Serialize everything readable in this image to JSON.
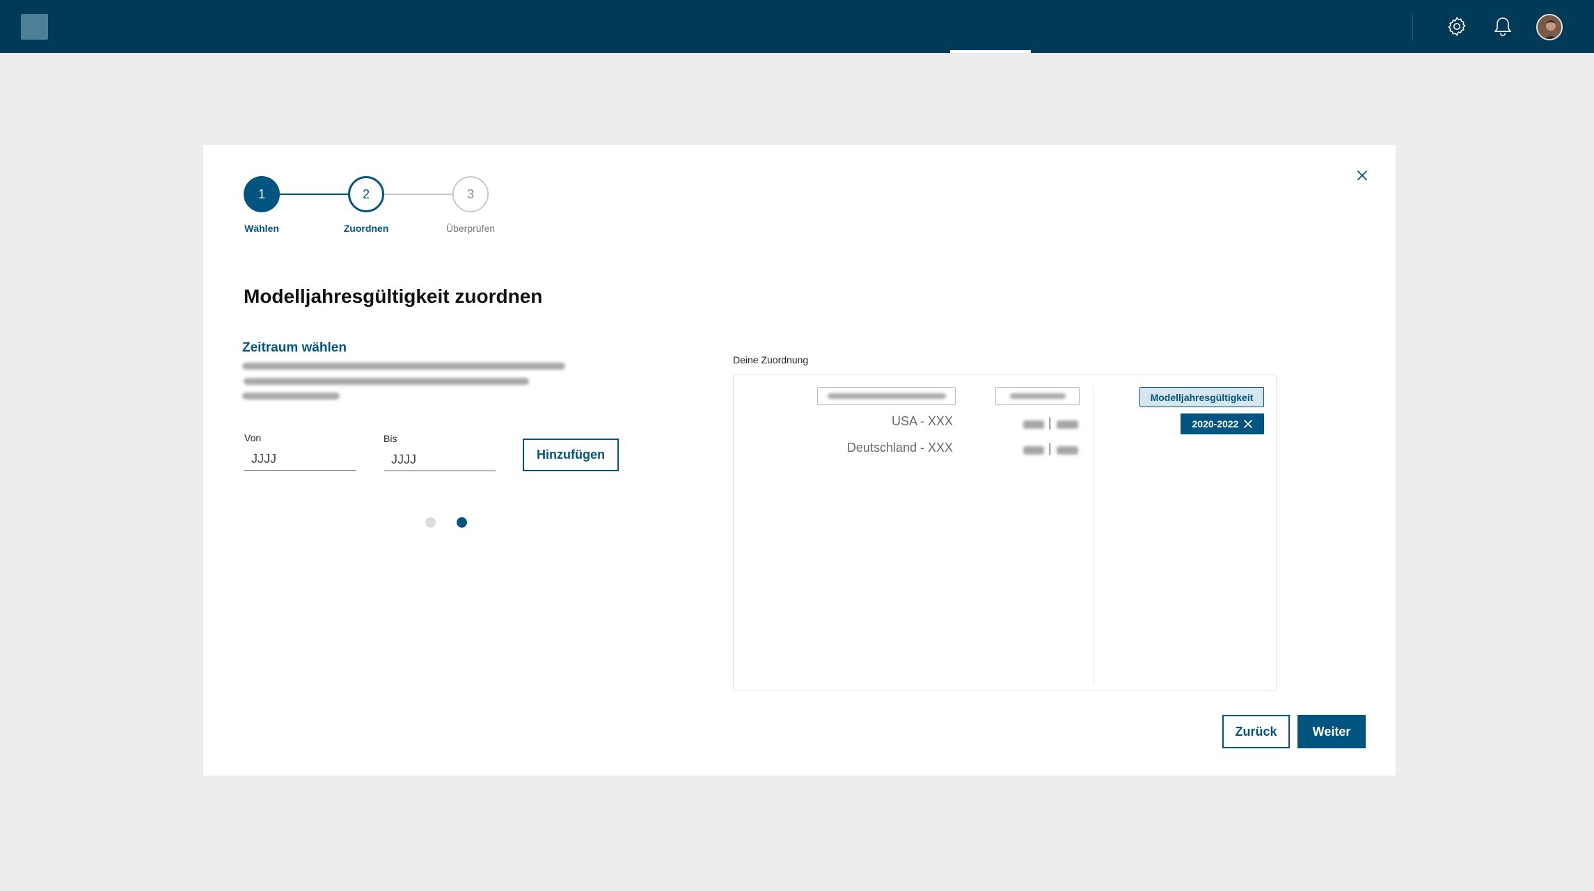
{
  "stepper": {
    "steps": [
      {
        "number": "1",
        "label": "Wählen"
      },
      {
        "number": "2",
        "label": "Zuordnen"
      },
      {
        "number": "3",
        "label": "Überprüfen"
      }
    ]
  },
  "page": {
    "title": "Modelljahresgültigkeit zuordnen"
  },
  "form": {
    "section_title": "Zeitraum wählen",
    "from_label": "Von",
    "from_placeholder": "JJJJ",
    "to_label": "Bis",
    "to_placeholder": "JJJJ",
    "add_button": "Hinzufügen"
  },
  "assignment": {
    "label": "Deine Zuordnung",
    "rows": [
      {
        "name": "USA - XXX"
      },
      {
        "name": "Deutschland - XXX"
      }
    ],
    "tag_header": "Modelljahresgültigkeit",
    "tag_value": "2020-2022"
  },
  "footer": {
    "back_button": "Zurück",
    "next_button": "Weiter"
  },
  "colors": {
    "brand": "#005580",
    "topbar": "#003a57"
  },
  "icons": {
    "settings": "gear-icon",
    "notifications": "bell-icon",
    "close": "close-icon"
  }
}
